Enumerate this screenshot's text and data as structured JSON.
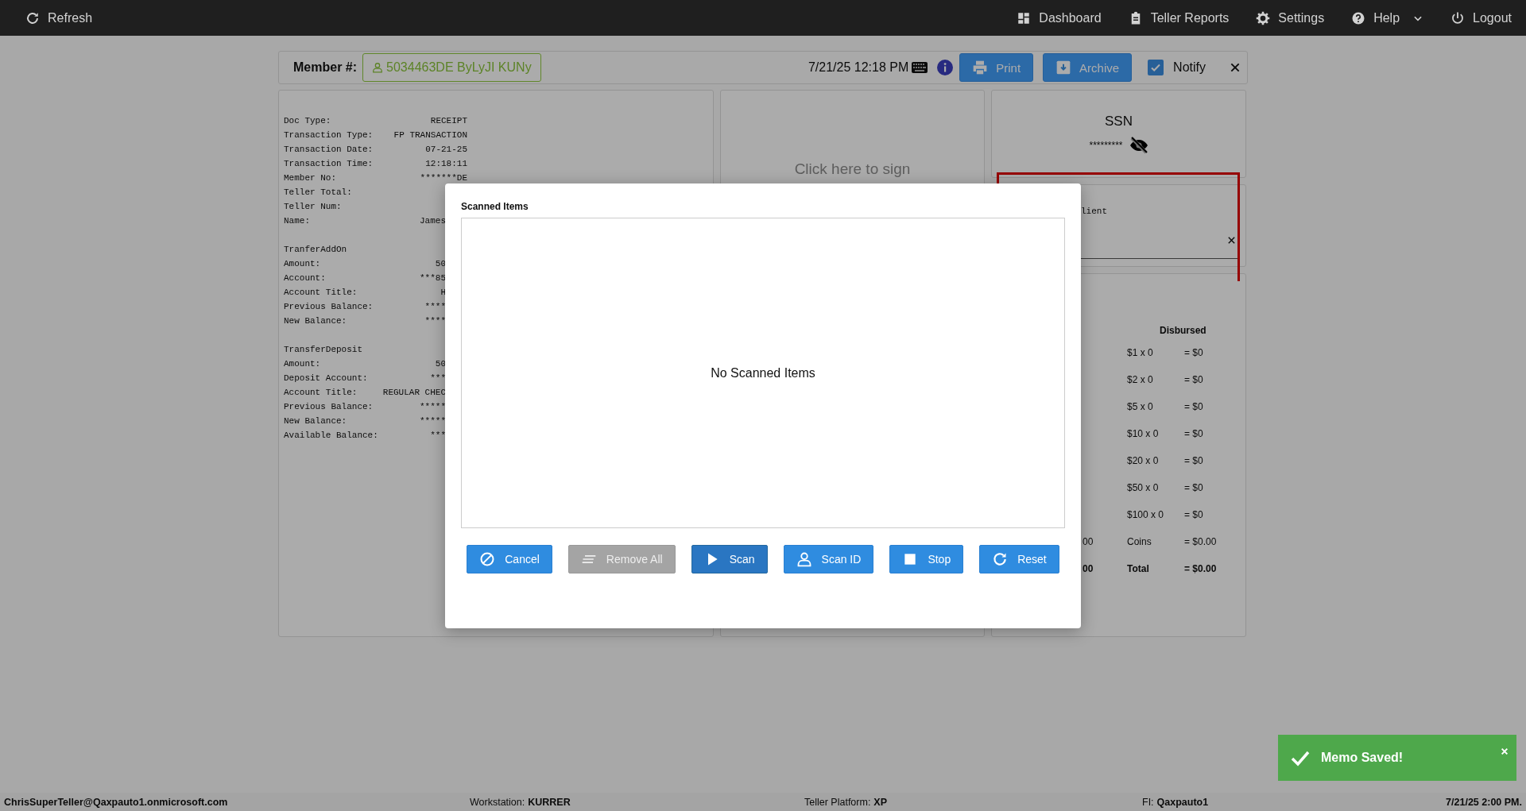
{
  "nav": {
    "left": [
      {
        "label": "Refresh"
      }
    ],
    "right": [
      {
        "label": "Dashboard",
        "dropdown": false
      },
      {
        "label": "Teller Reports",
        "dropdown": false
      },
      {
        "label": "Settings",
        "dropdown": false
      },
      {
        "label": "Help",
        "dropdown": true
      },
      {
        "label": "Logout",
        "dropdown": false
      }
    ]
  },
  "member_bar": {
    "label": "Member #:",
    "member": "5034463DE ByLyJI KUNy",
    "datetime": "7/21/25 12:18 PM",
    "buttons": [
      {
        "label": "Print"
      },
      {
        "label": "Archive"
      }
    ],
    "notify": {
      "label": "Notify",
      "checked": true
    }
  },
  "receipt": {
    "sections": [
      {
        "lines": [
          {
            "label": "Doc Type:",
            "value": "RECEIPT",
            "clipped": false
          },
          {
            "label": "Transaction Type:",
            "value": "FP TRANSACTION",
            "clipped": false
          },
          {
            "label": "Transaction Date:",
            "value": "07-21-25",
            "clipped": false
          },
          {
            "label": "Transaction Time:",
            "value": "12:18:11",
            "clipped": false
          },
          {
            "label": "Member No:",
            "value": "*******DE",
            "clipped": false
          },
          {
            "label": "Teller Total:"
          },
          {
            "label": "Teller Num:"
          },
          {
            "label": "Name:",
            "value": "James",
            "clipped": true
          }
        ]
      },
      {
        "heading": "TranferAddOn",
        "lines": [
          {
            "label": "Amount:",
            "value": "50",
            "clipped": true
          },
          {
            "label": "Account:",
            "value": "***85",
            "clipped": true
          },
          {
            "label": "Account Title:",
            "value": "H",
            "clipped": true
          },
          {
            "label": "Previous Balance:",
            "value": "****",
            "clipped": true
          },
          {
            "label": "New Balance:",
            "value": "****",
            "clipped": true
          }
        ]
      },
      {
        "heading": "TransferDeposit",
        "lines": [
          {
            "label": "Amount:",
            "value": "50",
            "clipped": true
          },
          {
            "label": "Deposit Account:",
            "value": "***",
            "clipped": true
          },
          {
            "label": "Account Title:",
            "value": "REGULAR CHEC",
            "clipped": true
          },
          {
            "label": "Previous Balance:",
            "value": "*****",
            "clipped": true
          },
          {
            "label": "New Balance:",
            "value": "*****",
            "clipped": true
          },
          {
            "label": "Available Balance:",
            "value": "***",
            "clipped": true
          }
        ]
      }
    ]
  },
  "signature": {
    "prompt": "Click here to sign"
  },
  "ssn": {
    "title": "SSN",
    "value": "*********",
    "masked": true
  },
  "memo": {
    "text": "lient",
    "highlighted": true
  },
  "cash": {
    "heading": "Disbursed",
    "rows": [
      {
        "denomination": "$1 x 0",
        "amount": "= $0",
        "bold": false
      },
      {
        "denomination": "$2 x 0",
        "amount": "= $0",
        "bold": false
      },
      {
        "denomination": "$5 x 0",
        "amount": "= $0",
        "bold": false
      },
      {
        "denomination": "$10 x 0",
        "amount": "= $0",
        "bold": false
      },
      {
        "denomination": "$20 x 0",
        "amount": "= $0",
        "bold": false
      },
      {
        "denomination": "$50 x 0",
        "amount": "= $0",
        "bold": false
      },
      {
        "denomination": "$100 x 0",
        "amount": "= $0",
        "bold": false
      },
      {
        "column_1": "00",
        "denomination": "Coins",
        "amount": "= $0.00",
        "bold": false
      },
      {
        "column_1": "00",
        "denomination": "Total",
        "amount": "= $0.00",
        "bold": true
      }
    ]
  },
  "modal": {
    "title": "Scanned Items",
    "empty_text": "No Scanned Items",
    "buttons": [
      {
        "label": "Cancel",
        "disabled": false,
        "active": false
      },
      {
        "label": "Remove All",
        "disabled": true,
        "active": false
      },
      {
        "label": "Scan",
        "disabled": false,
        "active": true
      },
      {
        "label": "Scan ID",
        "disabled": false,
        "active": false
      },
      {
        "label": "Stop",
        "disabled": false,
        "active": false
      },
      {
        "label": "Reset",
        "disabled": false,
        "active": false
      }
    ]
  },
  "toast": {
    "message": "Memo Saved!"
  },
  "status_bar": {
    "user": "ChrisSuperTeller@Qaxpauto1.onmicrosoft.com",
    "fields": [
      {
        "label": "Workstation:",
        "value": "KURRER"
      },
      {
        "label": "Teller Platform:",
        "value": "XP"
      },
      {
        "label": "FI:",
        "value": "Qaxpauto1"
      }
    ],
    "datetime": "7/21/25 2:00 PM."
  }
}
